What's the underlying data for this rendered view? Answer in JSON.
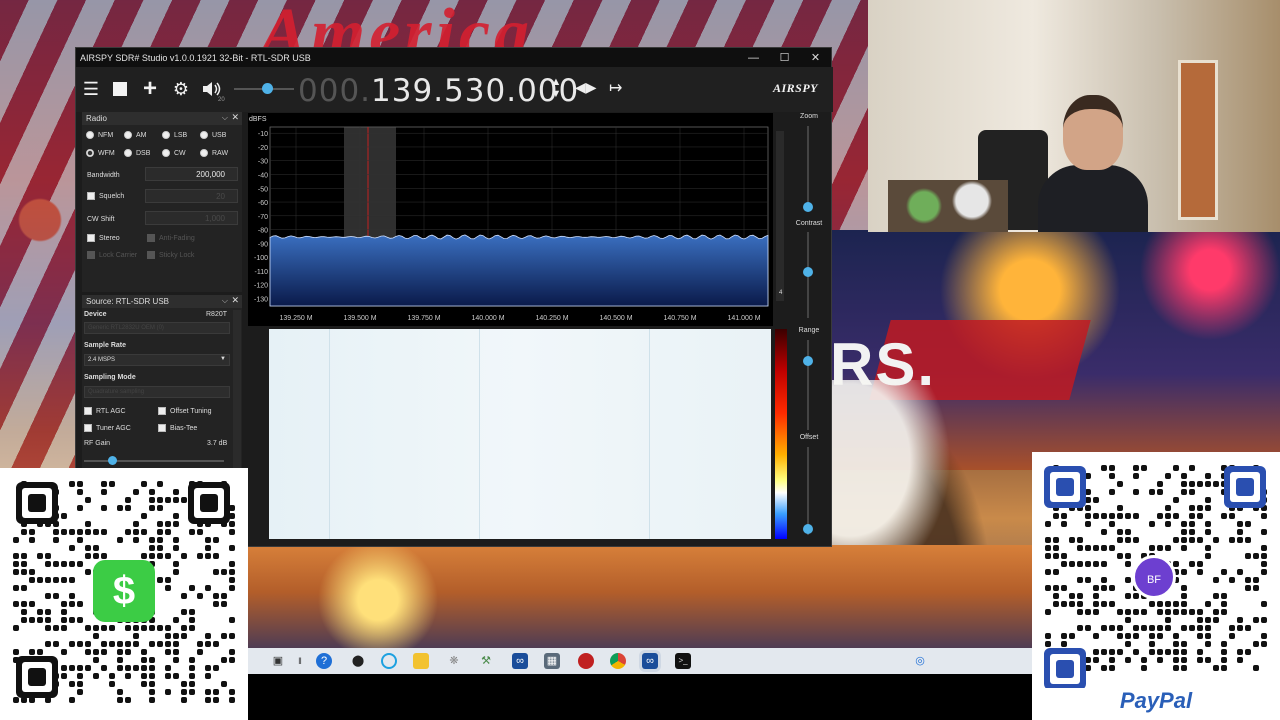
{
  "window": {
    "title": "AIRSPY SDR# Studio v1.0.0.1921 32-Bit - RTL-SDR USB",
    "controls": [
      "—",
      "☐",
      "✕"
    ]
  },
  "toolbar": {
    "volume_value": "20",
    "frequency_dim": "000.",
    "frequency_lit": "139.530.000",
    "brand": "AIRSPY"
  },
  "radio_panel": {
    "title": "Radio",
    "modes": [
      {
        "label": "NFM",
        "selected": false
      },
      {
        "label": "AM",
        "selected": false
      },
      {
        "label": "LSB",
        "selected": false
      },
      {
        "label": "USB",
        "selected": false
      },
      {
        "label": "WFM",
        "selected": true
      },
      {
        "label": "DSB",
        "selected": false
      },
      {
        "label": "CW",
        "selected": false
      },
      {
        "label": "RAW",
        "selected": false
      }
    ],
    "bandwidth_label": "Bandwidth",
    "bandwidth_value": "200,000",
    "squelch_label": "Squelch",
    "squelch_value": "20",
    "cw_shift_label": "CW Shift",
    "cw_shift_value": "1,000",
    "stereo_label": "Stereo",
    "anti_fading_label": "Anti-Fading",
    "lock_carrier_label": "Lock Carrier",
    "sticky_lock_label": "Sticky Lock"
  },
  "source_panel": {
    "title": "Source: RTL-SDR USB",
    "device_label": "Device",
    "device_value": "R820T",
    "device_select": "Generic RTL2832U OEM (0)",
    "sample_rate_label": "Sample Rate",
    "sample_rate_value": "2.4 MSPS",
    "sampling_mode_label": "Sampling Mode",
    "sampling_mode_value": "Quadrature sampling",
    "rtl_agc_label": "RTL AGC",
    "offset_tuning_label": "Offset Tuning",
    "tuner_agc_label": "Tuner AGC",
    "bias_tee_label": "Bias-Tee",
    "rf_gain_label": "RF Gain",
    "rf_gain_value": "3.7 dB"
  },
  "spectrum": {
    "unit": "dBFS",
    "y_ticks": [
      "-10",
      "-20",
      "-30",
      "-40",
      "-50",
      "-60",
      "-70",
      "-80",
      "-90",
      "-100",
      "-110",
      "-120",
      "-130"
    ],
    "x_ticks": [
      "139.250 M",
      "139.500 M",
      "139.750 M",
      "140.000 M",
      "140.250 M",
      "140.500 M",
      "140.750 M",
      "141.000 M"
    ],
    "scroll_num": "4"
  },
  "right_controls": {
    "zoom": "Zoom",
    "contrast": "Contrast",
    "range": "Range",
    "offset": "Offset"
  },
  "qr_left": {
    "logo": "$"
  },
  "qr_right": {
    "badge": "BF",
    "brand": "PayPal"
  },
  "overlay": {
    "headline": "RS."
  },
  "colors": {
    "accent": "#4fb2e8",
    "waterfall_bg": "#eef5f9",
    "spectrum_fill": "#1f4fa0"
  }
}
